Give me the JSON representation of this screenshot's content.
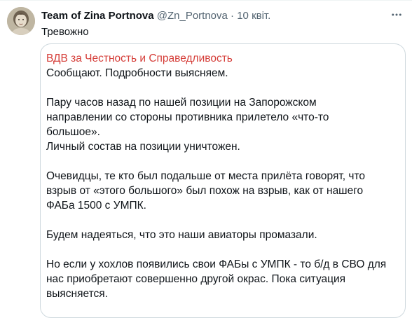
{
  "tweet": {
    "author_name": "Team of Zina Portnova",
    "author_handle": "@Zn_Portnova",
    "separator": "·",
    "timestamp": "10 квіт.",
    "text": "Тревожно",
    "more_icon": "more-horizontal-icon"
  },
  "quote": {
    "title": "ВДВ за Честность и Справедливость",
    "paragraphs": [
      "Сообщают. Подробности выясняем.",
      "Пару часов назад по нашей позиции на Запорожском\nнаправлении со стороны противника прилетело «что-то\nбольшое».\nЛичный состав на позиции уничтожен.",
      "Очевидцы, те кто был подальше от места прилёта говорят, что\nвзрыв от «этого большого» был похож на взрыв, как от нашего\nФАБа 1500 с УМПК.",
      "Будем надеяться, что это наши авиаторы промазали.",
      "Но если у хохлов появились свои ФАБы с УМПК - то б/д в СВО для\nнас приобретают совершенно другой окрас. Пока ситуация\nвыясняется."
    ]
  },
  "colors": {
    "title": "#d53d38",
    "text": "#0f1419",
    "secondary": "#536471",
    "border": "#cfd9de"
  }
}
